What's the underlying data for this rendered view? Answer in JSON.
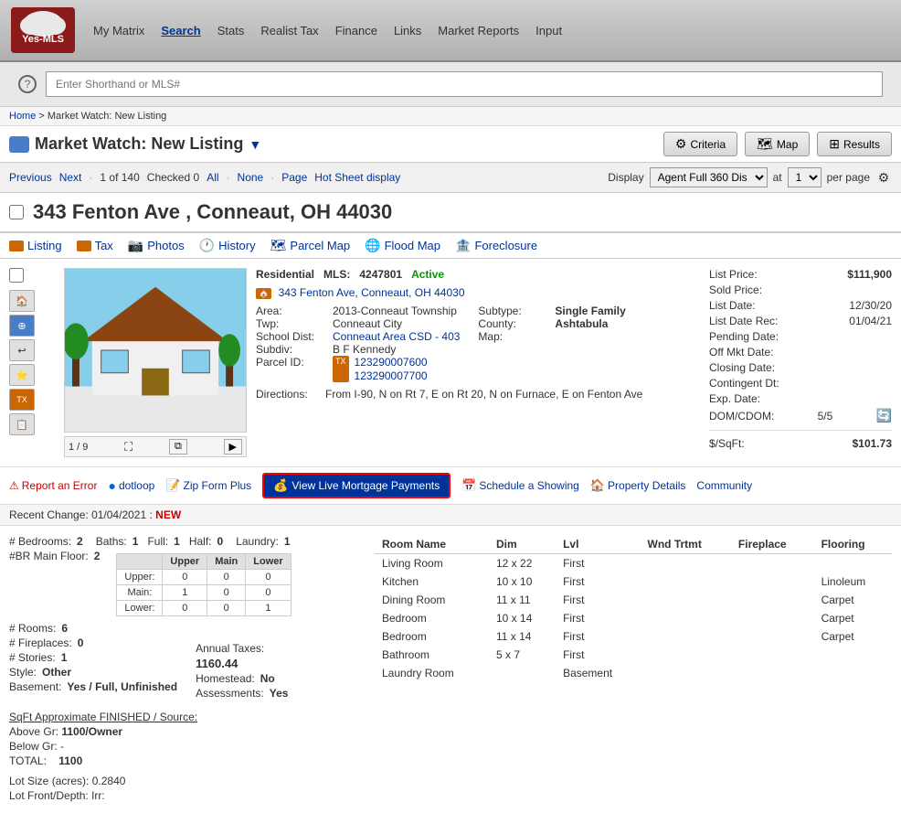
{
  "nav": {
    "logo_line1": "Yes-",
    "logo_line2": "MLS",
    "links": [
      {
        "label": "My Matrix",
        "active": false
      },
      {
        "label": "Search",
        "active": true
      },
      {
        "label": "Stats",
        "active": false
      },
      {
        "label": "Realist Tax",
        "active": false
      },
      {
        "label": "Finance",
        "active": false
      },
      {
        "label": "Links",
        "active": false
      },
      {
        "label": "Market Reports",
        "active": false
      },
      {
        "label": "Input",
        "active": false
      }
    ]
  },
  "search_bar": {
    "placeholder": "Enter Shorthand or MLS#",
    "help_symbol": "?"
  },
  "breadcrumb": {
    "home": "Home",
    "separator": " > ",
    "current": "Market Watch: New Listing"
  },
  "page_header": {
    "title": "Market Watch: New Listing",
    "dropdown_symbol": "▼",
    "criteria_btn": "Criteria",
    "map_btn": "Map",
    "results_btn": "Results"
  },
  "toolbar": {
    "previous": "Previous",
    "next": "Next",
    "current": "1",
    "total": "140",
    "checked_label": "Checked",
    "checked_count": "0",
    "all_label": "All",
    "none_label": "None",
    "page_label": "Page",
    "hot_sheet": "Hot Sheet display",
    "display_label": "Display",
    "display_option": "Agent Full 360 Dis",
    "at_label": "at",
    "at_value": "1",
    "per_page": "per page"
  },
  "property": {
    "address": "343 Fenton Ave , Conneaut, OH 44030",
    "checkbox_label": "",
    "type": "Residential",
    "mls_label": "MLS:",
    "mls_number": "4247801",
    "status": "Active",
    "address_link": "343 Fenton Ave, Conneaut, OH 44030",
    "area_label": "Area:",
    "area_value": "2013-Conneaut Township",
    "twp_label": "Twp:",
    "twp_value": "Conneaut City",
    "school_label": "School Dist:",
    "school_link": "Conneaut Area CSD - 403",
    "subdiv_label": "Subdiv:",
    "subdiv_value": "B F Kennedy",
    "parcel_label": "Parcel ID:",
    "parcel_link1": "123290007600",
    "parcel_link2": "123290007700",
    "subtype_label": "Subtype:",
    "subtype_value": "Single Family",
    "county_label": "County:",
    "county_value": "Ashtabula",
    "map_label": "Map:",
    "directions_label": "Directions:",
    "directions_value": "From I-90, N on Rt 7, E on Rt 20, N on Furnace, E on Fenton Ave",
    "image_count": "1 / 9"
  },
  "prices": {
    "list_price_label": "List Price:",
    "list_price_value": "$111,900",
    "sold_price_label": "Sold Price:",
    "sold_price_value": "",
    "list_date_label": "List Date:",
    "list_date_value": "12/30/20",
    "list_date_rec_label": "List Date Rec:",
    "list_date_rec_value": "01/04/21",
    "pending_date_label": "Pending Date:",
    "pending_date_value": "",
    "off_mkt_label": "Off Mkt Date:",
    "off_mkt_value": "",
    "closing_label": "Closing Date:",
    "closing_value": "",
    "contingent_label": "Contingent Dt:",
    "contingent_value": "",
    "exp_label": "Exp. Date:",
    "exp_value": "",
    "dom_label": "DOM/CDOM:",
    "dom_value": "5/5",
    "per_sqft_label": "$/SqFt:",
    "per_sqft_value": "$101.73"
  },
  "tabs": [
    {
      "label": "Listing",
      "icon": "house"
    },
    {
      "label": "Tax",
      "icon": "tax"
    },
    {
      "label": "Photos",
      "icon": "photo"
    },
    {
      "label": "History",
      "icon": "history"
    },
    {
      "label": "Parcel Map",
      "icon": "map"
    },
    {
      "label": "Flood Map",
      "icon": "flood"
    },
    {
      "label": "Foreclosure",
      "icon": "foreclosure"
    }
  ],
  "actions": {
    "report_error": "Report an Error",
    "dotloop": "dotloop",
    "zip_form": "Zip Form Plus",
    "schedule": "Schedule a Showing",
    "property_details": "Property Details",
    "community": "Community",
    "mortgage": "View Live Mortgage Payments"
  },
  "recent_change": {
    "label": "Recent Change:",
    "date": "01/04/2021",
    "separator": " : ",
    "value": "NEW"
  },
  "specs": {
    "bedrooms_label": "# Bedrooms:",
    "bedrooms_value": "2",
    "baths_label": "Baths:",
    "baths_value": "1",
    "full_label": "Full:",
    "full_value": "1",
    "half_label": "Half:",
    "half_value": "0",
    "laundry_label": "Laundry:",
    "laundry_value": "1",
    "br_main_label": "#BR Main Floor:",
    "br_main_value": "2",
    "rooms_label": "# Rooms:",
    "rooms_value": "6",
    "fireplaces_label": "# Fireplaces:",
    "fireplaces_value": "0",
    "stories_label": "# Stories:",
    "stories_value": "1",
    "style_label": "Style:",
    "style_value": "Other",
    "basement_label": "Basement:",
    "basement_value": "Yes / Full, Unfinished",
    "floor_headers": [
      "",
      "Upper",
      "Main",
      "Lower"
    ],
    "floor_rows": [
      [
        "Upper:",
        "0",
        "0",
        "0"
      ],
      [
        "Main:",
        "1",
        "0",
        "0"
      ],
      [
        "Lower:",
        "0",
        "0",
        "1"
      ]
    ],
    "annual_taxes_label": "Annual Taxes:",
    "annual_taxes_value": "1160.44",
    "homestead_label": "Homestead:",
    "homestead_value": "No",
    "assessments_label": "Assessments:",
    "assessments_value": "Yes"
  },
  "sqft": {
    "heading": "SqFt Approximate FINISHED / Source:",
    "above_label": "Above Gr:",
    "above_value": "1100/Owner",
    "below_label": "Below Gr:",
    "below_value": "-",
    "total_label": "TOTAL:",
    "total_value": "1100",
    "lot_size_label": "Lot Size (acres):",
    "lot_size_value": "0.2840",
    "lot_front_label": "Lot Front/Depth:",
    "lot_front_value": "Irr:"
  },
  "rooms": {
    "headers": [
      "Room Name",
      "Dim",
      "Lvl",
      "Wnd Trtmt",
      "Fireplace",
      "Flooring"
    ],
    "rows": [
      {
        "name": "Living Room",
        "dim": "12 x 22",
        "lvl": "First",
        "wnd": "",
        "fireplace": "",
        "flooring": ""
      },
      {
        "name": "Kitchen",
        "dim": "10 x 10",
        "lvl": "First",
        "wnd": "",
        "fireplace": "",
        "flooring": "Linoleum"
      },
      {
        "name": "Dining Room",
        "dim": "11 x 11",
        "lvl": "First",
        "wnd": "",
        "fireplace": "",
        "flooring": "Carpet"
      },
      {
        "name": "Bedroom",
        "dim": "10 x 14",
        "lvl": "First",
        "wnd": "",
        "fireplace": "",
        "flooring": "Carpet"
      },
      {
        "name": "Bedroom",
        "dim": "11 x 14",
        "lvl": "First",
        "wnd": "",
        "fireplace": "",
        "flooring": "Carpet"
      },
      {
        "name": "Bathroom",
        "dim": "5 x 7",
        "lvl": "First",
        "wnd": "",
        "fireplace": "",
        "flooring": ""
      },
      {
        "name": "Laundry Room",
        "dim": "",
        "lvl": "Basement",
        "wnd": "",
        "fireplace": "",
        "flooring": ""
      }
    ]
  }
}
